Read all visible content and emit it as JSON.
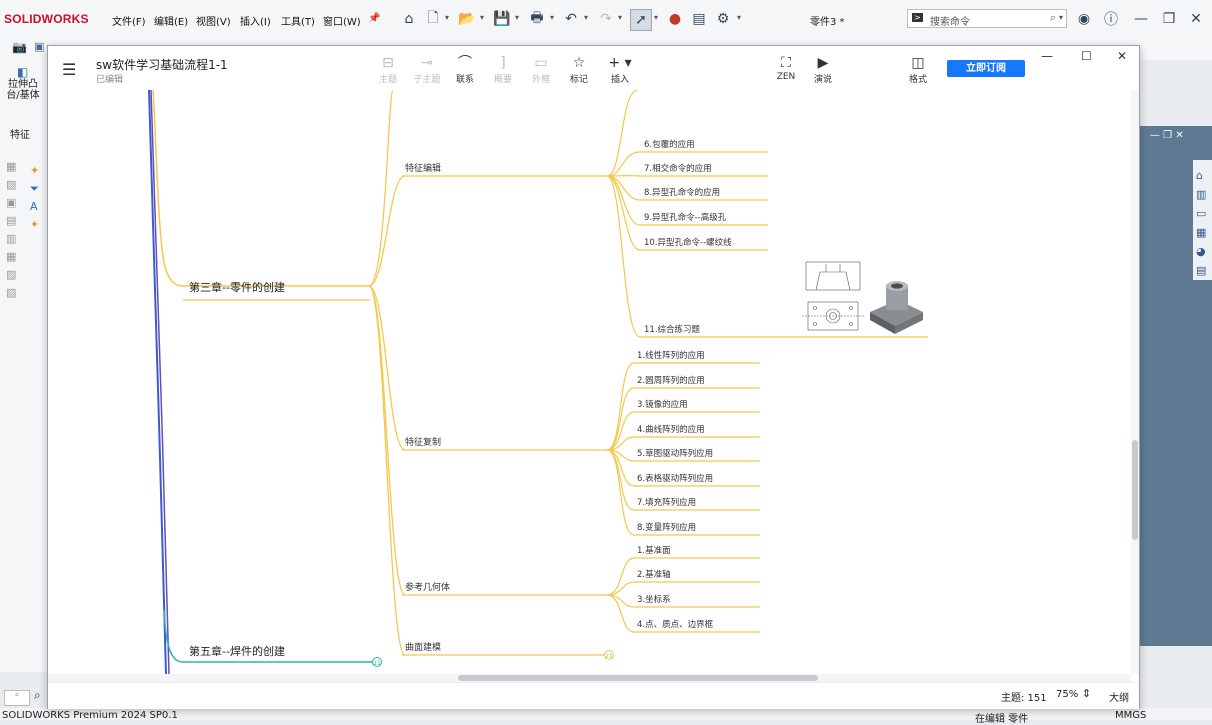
{
  "app": {
    "logo": "SOLIDWORKS",
    "menu": [
      "文件(F)",
      "编辑(E)",
      "视图(V)",
      "插入(I)",
      "工具(T)",
      "窗口(W)"
    ],
    "document_title": "零件3 *",
    "search": {
      "prompt": ">",
      "placeholder": "搜索命令"
    },
    "left_panel": {
      "extrude_label": "拉伸凸台/基体",
      "feature_tab": "特征"
    },
    "status": {
      "version": "SOLIDWORKS Premium 2024 SP0.1",
      "editing": "在编辑 零件",
      "units": "MMGS"
    }
  },
  "mindmap": {
    "doc_title": "sw软件学习基础流程1-1",
    "doc_status": "已编辑",
    "toolbar": [
      {
        "label": "主题",
        "icon": "topic-icon",
        "enabled": false
      },
      {
        "label": "子主题",
        "icon": "subtopic-icon",
        "enabled": false
      },
      {
        "label": "联系",
        "icon": "relationship-icon",
        "enabled": true
      },
      {
        "label": "概要",
        "icon": "summary-icon",
        "enabled": false
      },
      {
        "label": "外框",
        "icon": "boundary-icon",
        "enabled": false
      },
      {
        "label": "标记",
        "icon": "star-icon",
        "enabled": true
      },
      {
        "label": "插入",
        "icon": "plus-icon",
        "enabled": true
      },
      {
        "label": "ZEN",
        "icon": "zen-icon",
        "enabled": true
      },
      {
        "label": "演说",
        "icon": "pitch-icon",
        "enabled": true
      },
      {
        "label": "格式",
        "icon": "format-icon",
        "enabled": true
      }
    ],
    "subscribe": "立即订阅",
    "footer": {
      "topic_count": "主题: 151",
      "zoom": "75%",
      "outline": "大纲"
    },
    "nodes": {
      "ch3": "第三章--零件的创建",
      "ch5": "第五章--焊件的创建",
      "ch5_count": "11",
      "feature_edit": "特征编辑",
      "feature_copy": "特征复制",
      "ref_geometry": "参考几何体",
      "surface_modeling": "曲面建模",
      "surface_count": "21",
      "edit_items": [
        "6.包覆的应用",
        "7.相交命令的应用",
        "8.异型孔命令的应用",
        "9.异型孔命令--高级孔",
        "10.异型孔命令--螺纹线"
      ],
      "exercise": "11.综合练习题",
      "copy_items": [
        "1.线性阵列的应用",
        "2.圆周阵列的应用",
        "3.镜像的应用",
        "4.曲线阵列的应用",
        "5.草图驱动阵列应用",
        "6.表格驱动阵列应用",
        "7.填充阵列应用",
        "8.变量阵列应用"
      ],
      "ref_items": [
        "1.基准面",
        "2.基准轴",
        "3.坐标系",
        "4.点、质点、边界框"
      ]
    }
  },
  "colors": {
    "branch": "#f2c94c",
    "ch5_branch": "#2cb5a3",
    "spine_blue": "#3b5bd6",
    "spine_purple": "#6a4bb5",
    "accent": "#1677ff"
  }
}
